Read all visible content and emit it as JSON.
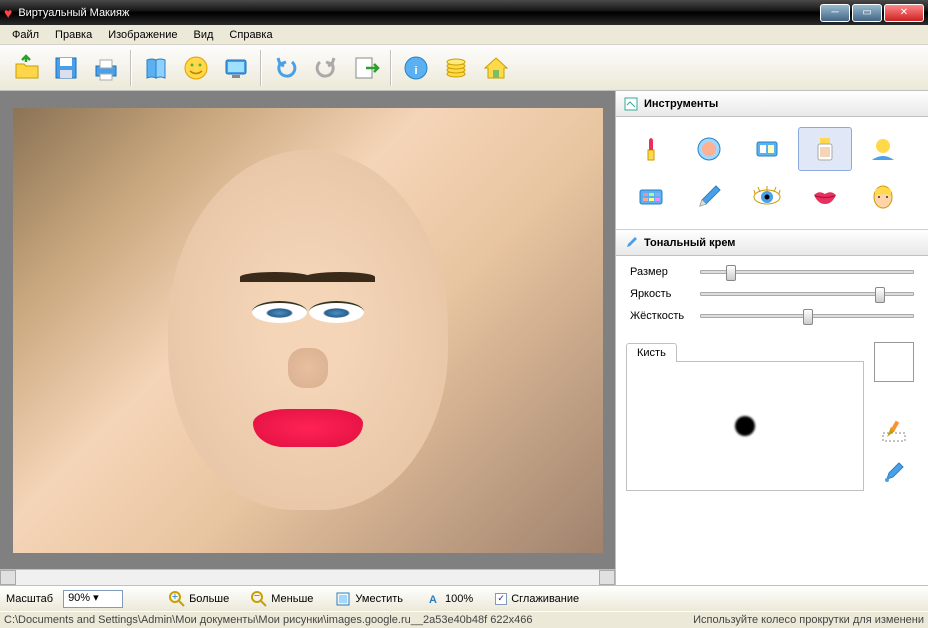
{
  "title": "Виртуальный Макияж",
  "menu": [
    "Файл",
    "Правка",
    "Изображение",
    "Вид",
    "Справка"
  ],
  "panels": {
    "tools": "Инструменты",
    "current": "Тональный крем"
  },
  "sliders": {
    "size": {
      "label": "Размер",
      "pos": 12
    },
    "brightness": {
      "label": "Яркость",
      "pos": 82
    },
    "hardness": {
      "label": "Жёсткость",
      "pos": 48
    }
  },
  "brush_tab": "Кисть",
  "bottom": {
    "scale_label": "Масштаб",
    "scale_value": "90%",
    "zoom_in": "Больше",
    "zoom_out": "Меньше",
    "fit": "Уместить",
    "hundred": "100%",
    "smoothing": "Сглаживание",
    "smoothing_checked": true
  },
  "status": {
    "path": "C:\\Documents and Settings\\Admin\\Мои документы\\Мои рисунки\\images.google.ru__2a53e40b48f 622x466",
    "hint": "Используйте колесо прокрутки для изменени"
  },
  "tool_names": [
    "lipstick",
    "blush",
    "eyeshadow-single",
    "foundation",
    "tan",
    "eyeshadow-palette",
    "pencil",
    "eye-color",
    "lips-smile",
    "face-shape"
  ],
  "selected_tool": 3
}
